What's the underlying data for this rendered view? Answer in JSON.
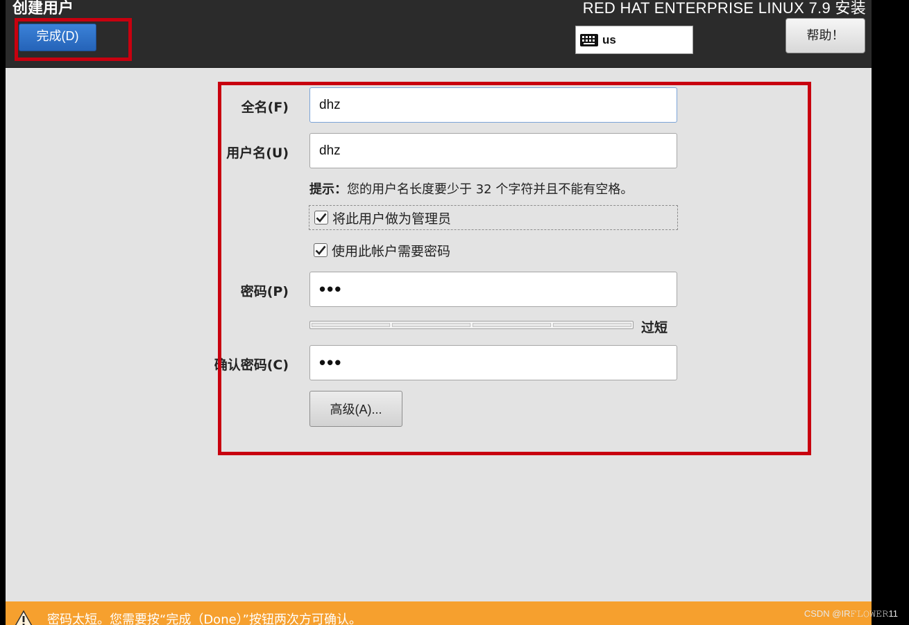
{
  "header": {
    "page_title": "创建用户",
    "done_label": "完成(D)",
    "product_title": "RED HAT ENTERPRISE LINUX 7.9 安装",
    "keyboard_layout": "us",
    "help_label": "帮助！"
  },
  "form": {
    "fullname_label": "全名(F)",
    "fullname_value": "dhz",
    "username_label": "用户名(U)",
    "username_value": "dhz",
    "hint_prefix": "提示：",
    "hint_text": "您的用户名长度要少于 32 个字符并且不能有空格。",
    "admin_checkbox_label": "将此用户做为管理员",
    "admin_checked": true,
    "require_password_label": "使用此帐户需要密码",
    "require_password_checked": true,
    "password_label": "密码(P)",
    "password_value": "•••",
    "strength_label": "过短",
    "strength_level": 0,
    "confirm_label": "确认密码(C)",
    "confirm_value": "•••",
    "advanced_label": "高级(A)..."
  },
  "warning": {
    "text": "密码太短。您需要按“完成（Done）”按钮两次方可确认。"
  },
  "watermark": "CSDN @IR𝙵𝙻𝙾𝚆𝙴𝚁11",
  "colors": {
    "header_bg": "#2b2b2b",
    "done_button": "#2f6fc7",
    "highlight_box": "#c8000f",
    "warning_bar": "#f6a02e"
  },
  "icons": [
    "keyboard-icon",
    "checkmark-icon",
    "warning-icon"
  ]
}
